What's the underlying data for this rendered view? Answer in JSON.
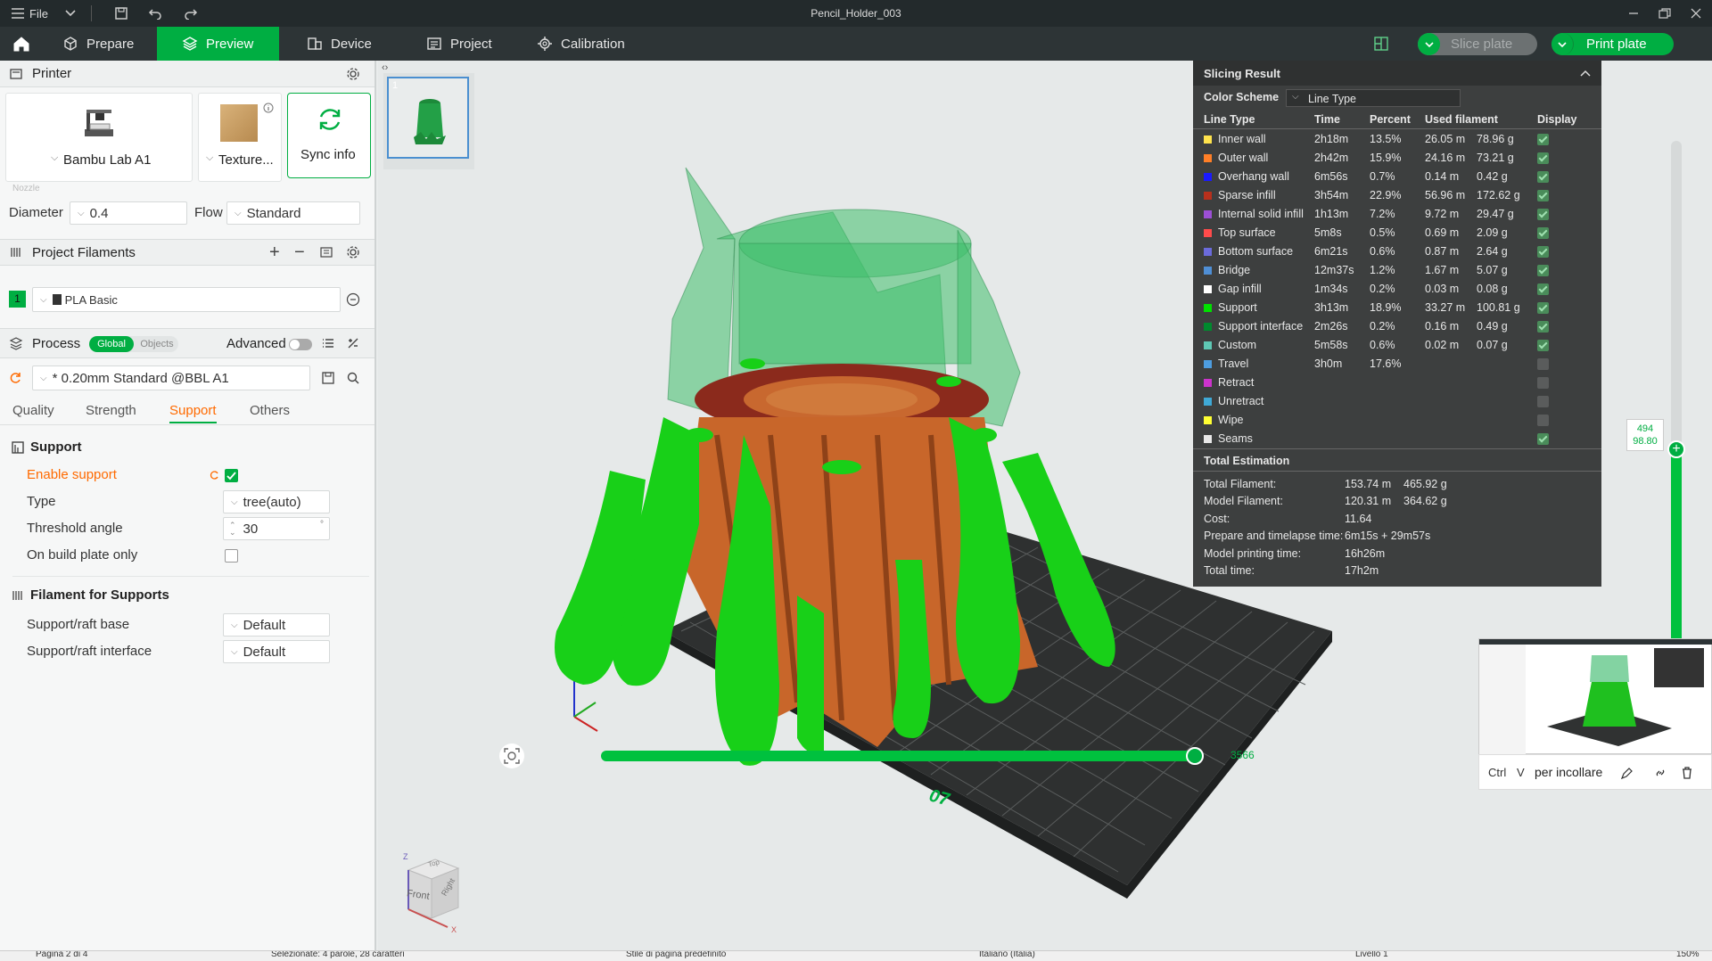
{
  "titlebar": {
    "file_menu": "File",
    "window_title": "Pencil_Holder_003"
  },
  "nav": {
    "tabs": [
      {
        "label": "Prepare",
        "icon": "cube-icon"
      },
      {
        "label": "Preview",
        "icon": "preview-icon",
        "active": true
      },
      {
        "label": "Device",
        "icon": "device-icon"
      },
      {
        "label": "Project",
        "icon": "project-icon"
      },
      {
        "label": "Calibration",
        "icon": "calibration-icon"
      }
    ],
    "slice_label": "Slice plate",
    "print_label": "Print plate"
  },
  "printer": {
    "section_title": "Printer",
    "printer_name": "Bambu Lab A1",
    "plate_name": "Texture...",
    "sync_label": "Sync info",
    "nozzle_label": "Nozzle",
    "diameter_label": "Diameter",
    "diameter_value": "0.4",
    "flow_label": "Flow",
    "flow_value": "Standard"
  },
  "filaments": {
    "section_title": "Project Filaments",
    "items": [
      {
        "index": "1",
        "name": "PLA Basic",
        "color": "#00ae42"
      }
    ]
  },
  "process": {
    "section_title": "Process",
    "toggle_global": "Global",
    "toggle_objects": "Objects",
    "advanced_label": "Advanced",
    "preset": "* 0.20mm Standard @BBL A1",
    "tabs": [
      "Quality",
      "Strength",
      "Support",
      "Others"
    ],
    "active_tab": "Support"
  },
  "support": {
    "group_title": "Support",
    "enable_label": "Enable support",
    "enable_value": true,
    "type_label": "Type",
    "type_value": "tree(auto)",
    "threshold_label": "Threshold angle",
    "threshold_value": "30",
    "threshold_unit": "°",
    "build_plate_label": "On build plate only",
    "build_plate_value": false,
    "filament_group_title": "Filament for Supports",
    "raft_base_label": "Support/raft base",
    "raft_base_value": "Default",
    "raft_interface_label": "Support/raft interface",
    "raft_interface_value": "Default"
  },
  "plate_thumb": {
    "index": "1"
  },
  "slicing": {
    "title": "Slicing Result",
    "color_scheme_label": "Color Scheme",
    "color_scheme_value": "Line Type",
    "headers": {
      "type": "Line Type",
      "time": "Time",
      "percent": "Percent",
      "used": "Used filament",
      "display": "Display"
    },
    "rows": [
      {
        "name": "Inner wall",
        "color": "#ffe34d",
        "time": "2h18m",
        "percent": "13.5%",
        "m": "26.05 m",
        "g": "78.96 g",
        "display": true
      },
      {
        "name": "Outer wall",
        "color": "#ff7f27",
        "time": "2h42m",
        "percent": "15.9%",
        "m": "24.16 m",
        "g": "73.21 g",
        "display": true
      },
      {
        "name": "Overhang wall",
        "color": "#1a1aff",
        "time": "6m56s",
        "percent": "0.7%",
        "m": "0.14 m",
        "g": "0.42 g",
        "display": true
      },
      {
        "name": "Sparse infill",
        "color": "#b8301c",
        "time": "3h54m",
        "percent": "22.9%",
        "m": "56.96 m",
        "g": "172.62 g",
        "display": true
      },
      {
        "name": "Internal solid infill",
        "color": "#9c4fd6",
        "time": "1h13m",
        "percent": "7.2%",
        "m": "9.72 m",
        "g": "29.47 g",
        "display": true
      },
      {
        "name": "Top surface",
        "color": "#ff4b4b",
        "time": "5m8s",
        "percent": "0.5%",
        "m": "0.69 m",
        "g": "2.09 g",
        "display": true
      },
      {
        "name": "Bottom surface",
        "color": "#6b6bdb",
        "time": "6m21s",
        "percent": "0.6%",
        "m": "0.87 m",
        "g": "2.64 g",
        "display": true
      },
      {
        "name": "Bridge",
        "color": "#4f8fd6",
        "time": "12m37s",
        "percent": "1.2%",
        "m": "1.67 m",
        "g": "5.07 g",
        "display": true
      },
      {
        "name": "Gap infill",
        "color": "#ffffff",
        "time": "1m34s",
        "percent": "0.2%",
        "m": "0.03 m",
        "g": "0.08 g",
        "display": true
      },
      {
        "name": "Support",
        "color": "#00e000",
        "time": "3h13m",
        "percent": "18.9%",
        "m": "33.27 m",
        "g": "100.81 g",
        "display": true
      },
      {
        "name": "Support interface",
        "color": "#008a2e",
        "time": "2m26s",
        "percent": "0.2%",
        "m": "0.16 m",
        "g": "0.49 g",
        "display": true
      },
      {
        "name": "Custom",
        "color": "#5ec8b4",
        "time": "5m58s",
        "percent": "0.6%",
        "m": "0.02 m",
        "g": "0.07 g",
        "display": true
      },
      {
        "name": "Travel",
        "color": "#4d9de0",
        "time": "3h0m",
        "percent": "17.6%",
        "m": "",
        "g": "",
        "display": false
      },
      {
        "name": "Retract",
        "color": "#cc33cc",
        "time": "",
        "percent": "",
        "m": "",
        "g": "",
        "display": false
      },
      {
        "name": "Unretract",
        "color": "#3fa9d6",
        "time": "",
        "percent": "",
        "m": "",
        "g": "",
        "display": false
      },
      {
        "name": "Wipe",
        "color": "#ffff33",
        "time": "",
        "percent": "",
        "m": "",
        "g": "",
        "display": false
      },
      {
        "name": "Seams",
        "color": "#e8e8e8",
        "time": "",
        "percent": "",
        "m": "",
        "g": "",
        "display": true
      }
    ],
    "total_title": "Total Estimation",
    "totals": [
      {
        "label": "Total Filament:",
        "v1": "153.74 m",
        "v2": "465.92 g"
      },
      {
        "label": "Model Filament:",
        "v1": "120.31 m",
        "v2": "364.62 g"
      },
      {
        "label": "Cost:",
        "v1": "11.64",
        "v2": ""
      },
      {
        "label": "Prepare and timelapse time:",
        "v1": "6m15s + 29m57s",
        "v2": ""
      },
      {
        "label": "Model printing time:",
        "v1": "16h26m",
        "v2": ""
      },
      {
        "label": "Total time:",
        "v1": "17h2m",
        "v2": ""
      }
    ]
  },
  "layer_slider": {
    "layer": "494",
    "height": "98.80"
  },
  "move_slider": {
    "value": "3566"
  },
  "plate_number": "07",
  "nav_cube": {
    "front": "Front",
    "right": "Right",
    "top": "Top",
    "z": "Z",
    "x": "X"
  },
  "clipboard": {
    "ctrl": "Ctrl",
    "key": "V",
    "text": "per incollare"
  },
  "statusbar": {
    "page": "Pagina 2 di 4",
    "selection": "Selezionate: 4 parole, 28 caratteri",
    "style": "Stile di pagina predefinito",
    "language": "Italiano (Italia)",
    "level": "Livello 1",
    "zoom": "150%"
  }
}
